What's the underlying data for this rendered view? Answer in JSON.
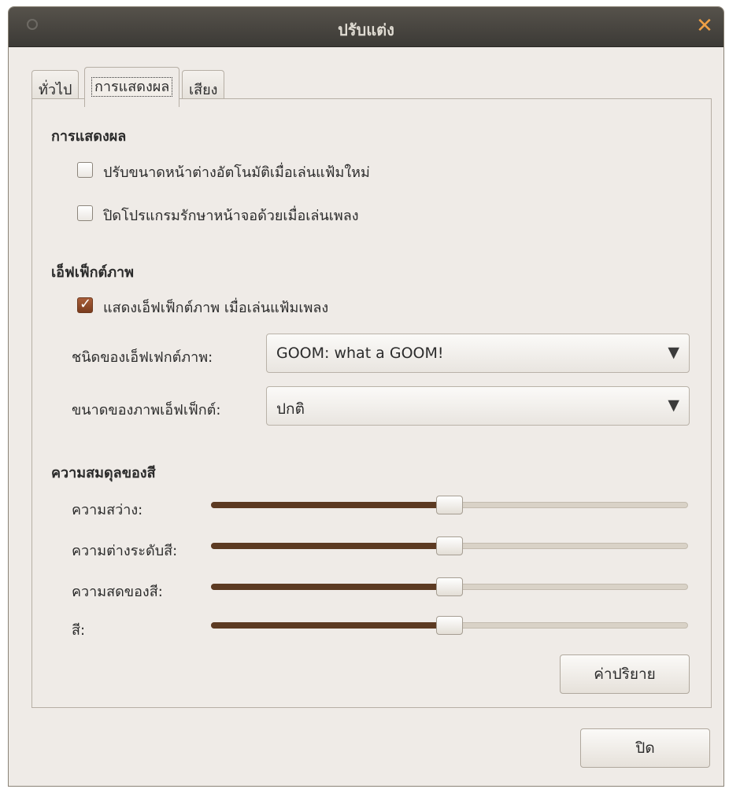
{
  "window": {
    "title": "ปรับแต่ง"
  },
  "tabs": [
    {
      "label": "ทั่วไป",
      "active": false
    },
    {
      "label": "การแสดงผล",
      "active": true
    },
    {
      "label": "เสียง",
      "active": false
    }
  ],
  "display": {
    "heading": "การแสดงผล",
    "options": [
      {
        "label": "ปรับขนาดหน้าต่างอัตโนมัติเมื่อเล่นแฟ้มใหม่",
        "checked": false
      },
      {
        "label": "ปิดโปรแกรมรักษาหน้าจอด้วยเมื่อเล่นเพลง",
        "checked": false
      }
    ]
  },
  "visual_effects": {
    "heading": "เอ็ฟเฟ็กต์ภาพ",
    "show_option": {
      "label": "แสดงเอ็ฟเฟ็กต์ภาพ เมื่อเล่นแฟ้มเพลง",
      "checked": true
    },
    "type_label": "ชนิดของเอ็ฟเฟกต์ภาพ:",
    "type_value": "GOOM: what a GOOM!",
    "size_label": "ขนาดของภาพเอ็ฟเฟ็กต์:",
    "size_value": "ปกติ"
  },
  "color_balance": {
    "heading": "ความสมดุลของสี",
    "sliders": [
      {
        "label": "ความสว่าง:",
        "value": 0.5
      },
      {
        "label": "ความต่างระดับสี:",
        "value": 0.5
      },
      {
        "label": "ความสดของสี:",
        "value": 0.5
      },
      {
        "label": "สี:",
        "value": 0.5
      }
    ],
    "reset_label": "ค่าปริยาย"
  },
  "close_label": "ปิด",
  "colors": {
    "accent": "#5c3a22",
    "close_icon": "#f0a045",
    "titlebar": "#3c3a36"
  }
}
